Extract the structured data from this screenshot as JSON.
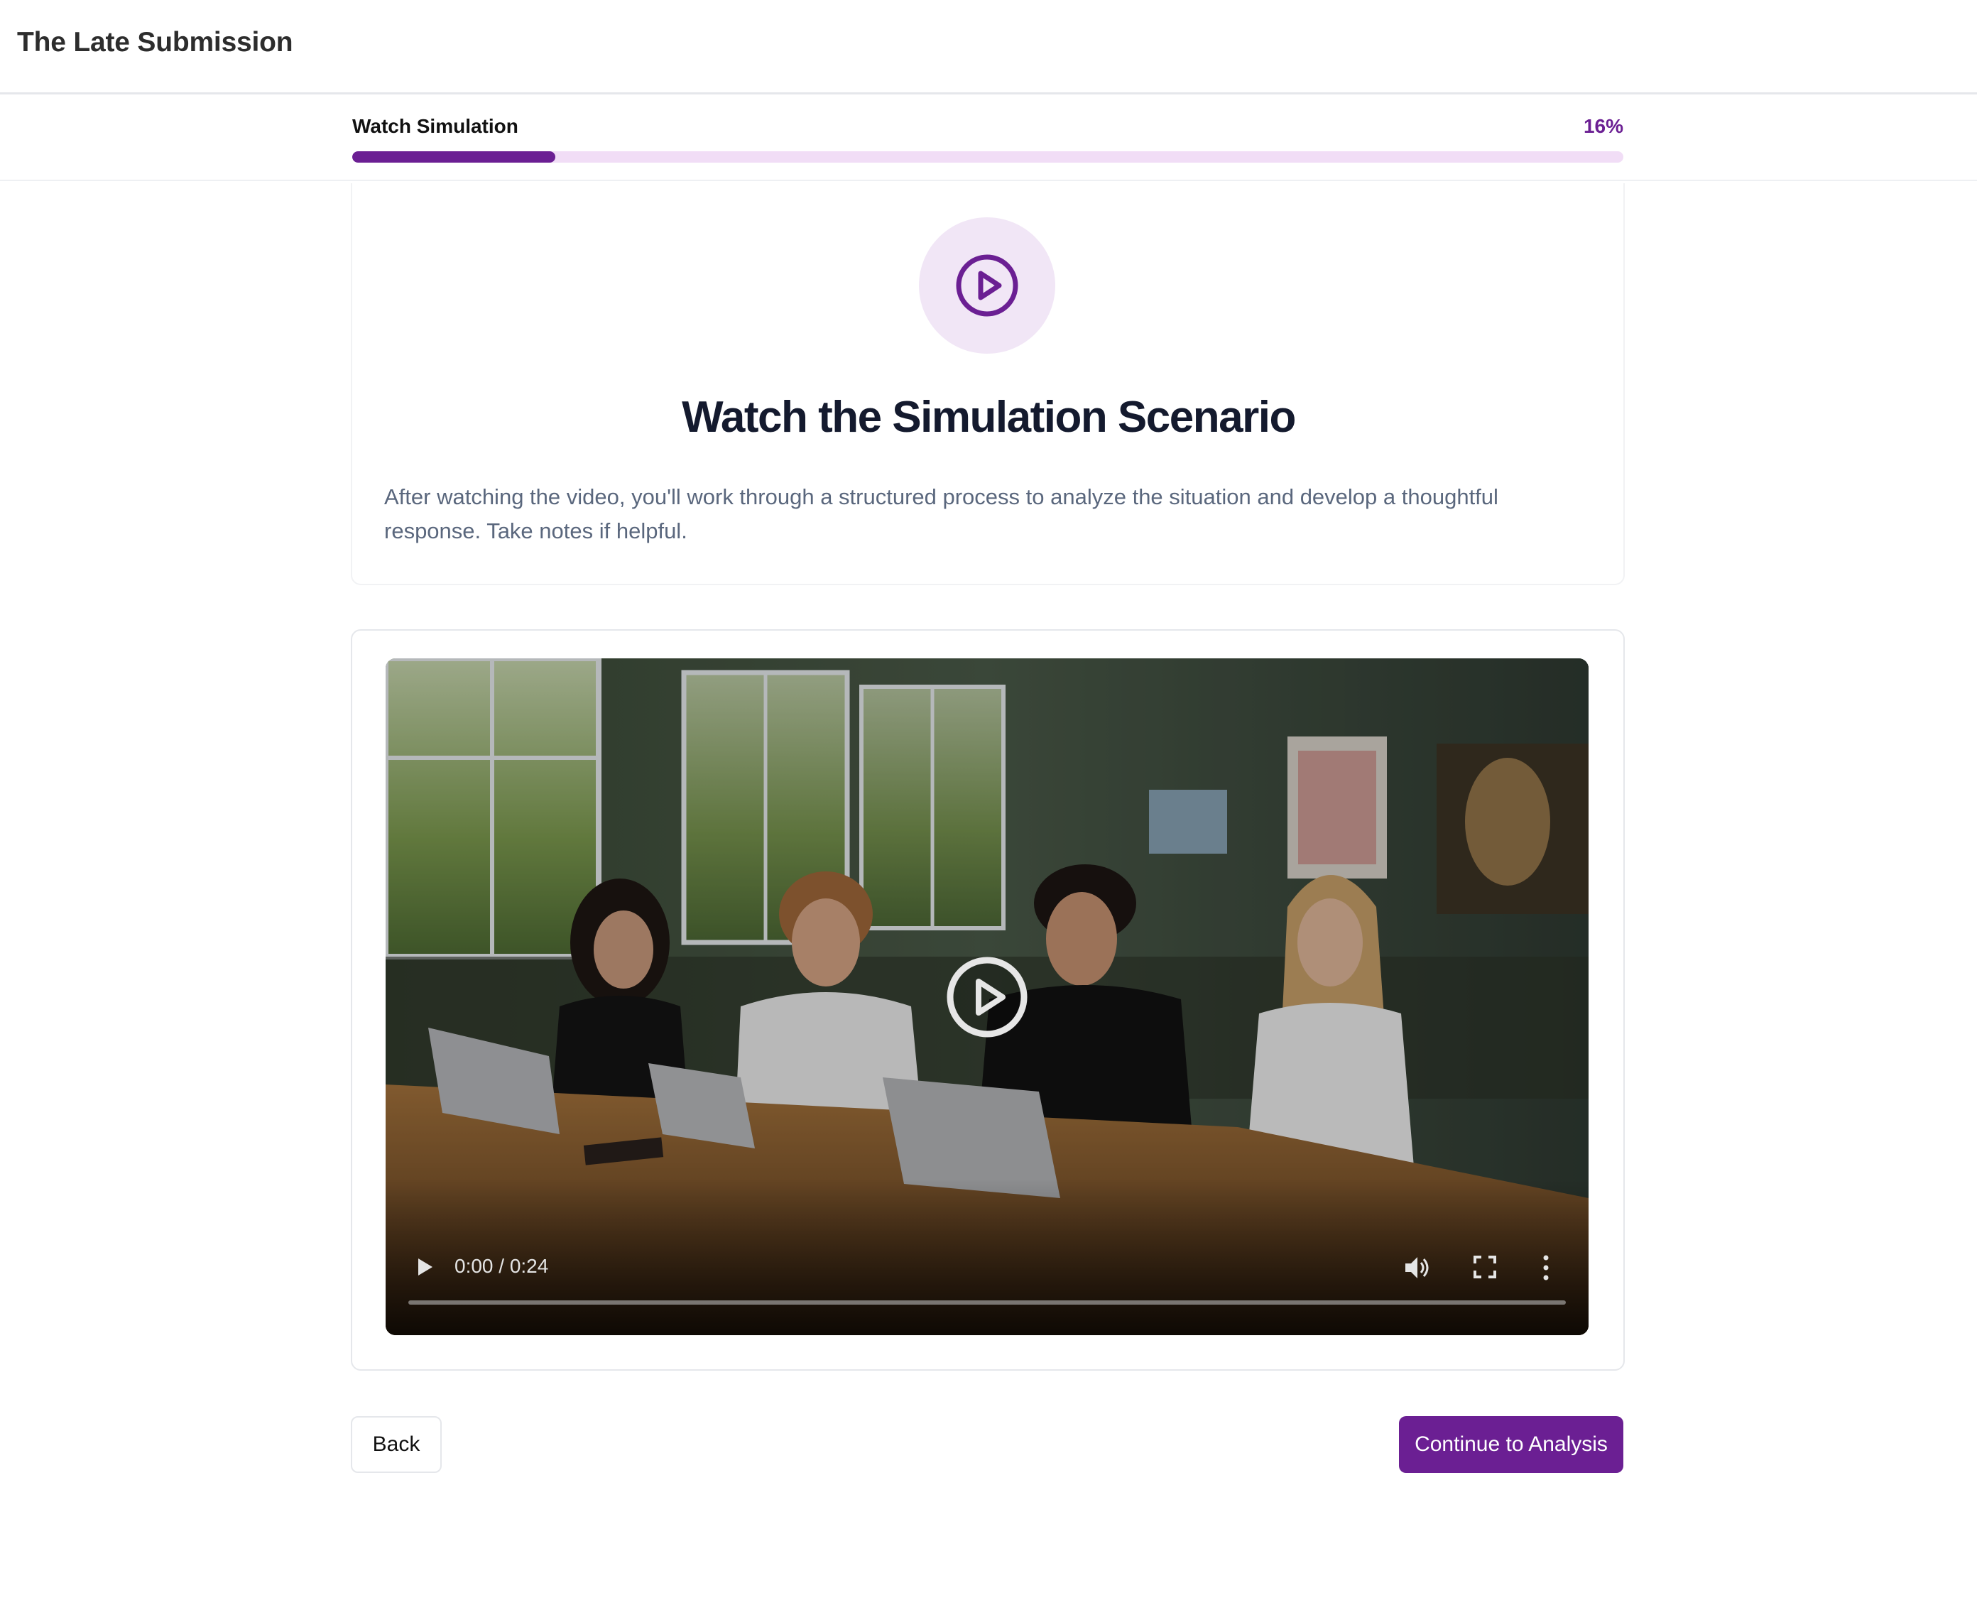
{
  "header": {
    "title": "The Late Submission"
  },
  "progress": {
    "step_label": "Watch Simulation",
    "percent_label": "16%",
    "fraction": 0.16
  },
  "intro": {
    "icon": "play-circle-icon",
    "heading": "Watch the Simulation Scenario",
    "description": "After watching the video, you'll work through a structured process to analyze the situation and develop a thoughtful response. Take notes if helpful."
  },
  "video": {
    "time_display": "0:00 / 0:24",
    "controls": [
      "play-icon",
      "volume-icon",
      "fullscreen-icon",
      "more-options-icon"
    ],
    "progress_fraction": 0
  },
  "actions": {
    "back_label": "Back",
    "continue_label": "Continue to Analysis"
  },
  "colors": {
    "accent": "#6b1f93",
    "accent_light": "#f1ddf6",
    "badge_bg": "#f1e6f6"
  }
}
